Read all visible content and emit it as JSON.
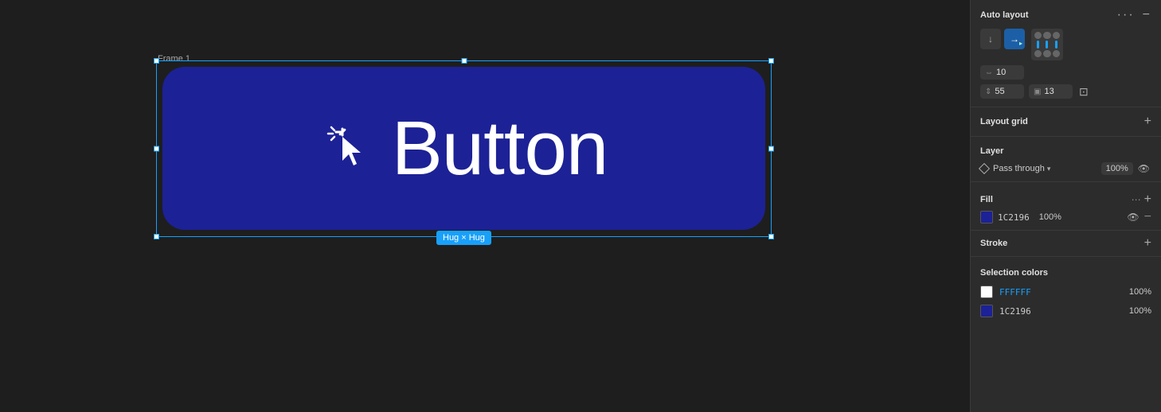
{
  "canvas": {
    "frame_label": "Frame 1",
    "hug_label": "Hug × Hug",
    "button_text": "Button"
  },
  "panel": {
    "auto_layout": {
      "title": "Auto layout",
      "spacing_horizontal": "10",
      "spacing_vertical": "55",
      "padding_top": "13"
    },
    "layout_grid": {
      "title": "Layout grid"
    },
    "layer": {
      "title": "Layer",
      "mode": "Pass through",
      "opacity": "100%"
    },
    "fill": {
      "title": "Fill",
      "color": "1C2196",
      "opacity": "100%"
    },
    "stroke": {
      "title": "Stroke"
    },
    "selection_colors": {
      "title": "Selection colors",
      "items": [
        {
          "color": "FFFFFF",
          "hex_display": "FFFFFF",
          "opacity": "100%",
          "swatch": "#ffffff"
        },
        {
          "color": "1C2196",
          "hex_display": "1C2196",
          "opacity": "100%",
          "swatch": "#1c2196"
        }
      ]
    }
  },
  "icons": {
    "close": "×",
    "plus": "+",
    "minus": "−",
    "eye": "👁",
    "dots": "⋯",
    "chevron_down": "▾",
    "arrow_down": "↓",
    "arrow_right": "→"
  }
}
